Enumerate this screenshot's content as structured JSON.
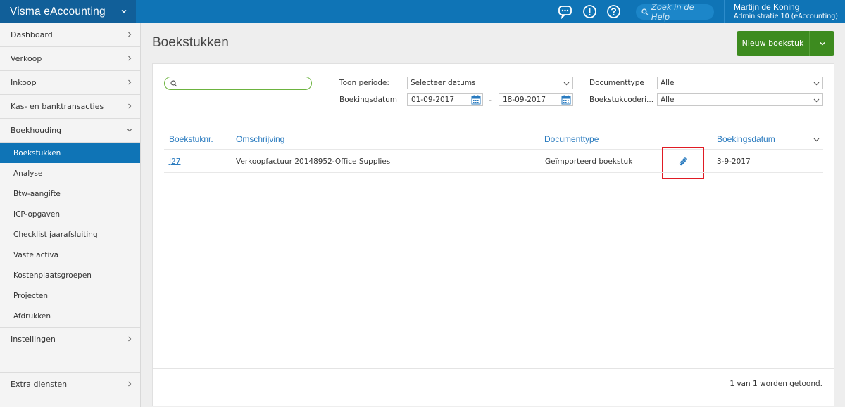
{
  "app": {
    "title": "Visma eAccounting",
    "help_search_placeholder": "Zoek in de Help",
    "user_name": "Martijn de Koning",
    "administration": "Administratie 10 (eAccounting)"
  },
  "sidebar": {
    "items": [
      {
        "label": "Dashboard"
      },
      {
        "label": "Verkoop"
      },
      {
        "label": "Inkoop"
      },
      {
        "label": "Kas- en banktransacties"
      },
      {
        "label": "Boekhouding"
      }
    ],
    "subitems": [
      {
        "label": "Boekstukken"
      },
      {
        "label": "Analyse"
      },
      {
        "label": "Btw-aangifte"
      },
      {
        "label": "ICP-opgaven"
      },
      {
        "label": "Checklist jaarafsluiting"
      },
      {
        "label": "Vaste activa"
      },
      {
        "label": "Kostenplaatsgroepen"
      },
      {
        "label": "Projecten"
      },
      {
        "label": "Afdrukken"
      }
    ],
    "settings": "Instellingen",
    "extra": "Extra diensten"
  },
  "page": {
    "title": "Boekstukken",
    "new_button": "Nieuw boekstuk"
  },
  "filters": {
    "period_label": "Toon periode:",
    "period_value": "Selecteer datums",
    "booking_date_label": "Boekingsdatum",
    "date_from": "01-09-2017",
    "date_sep": "-",
    "date_to": "18-09-2017",
    "doctype_label": "Documenttype",
    "doctype_value": "Alle",
    "coding_label": "Boekstukcoderi...",
    "coding_value": "Alle"
  },
  "table": {
    "headers": [
      "Boekstuknr.",
      "Omschrijving",
      "Documenttype",
      "Boekingsdatum"
    ],
    "rows": [
      {
        "nr": "J27",
        "description": "Verkoopfactuur 20148952-Office Supplies",
        "doctype": "Geïmporteerd boekstuk",
        "date": "3-9-2017"
      }
    ]
  },
  "footer": {
    "count_text": "1 van 1 worden getoond."
  },
  "colors": {
    "topbar": "#0f74b6",
    "brand_bg": "#115f99",
    "active_nav": "#0f74b6",
    "primary_button": "#3d8b1f",
    "link": "#2a7bbf",
    "highlight_box": "#e01b24"
  }
}
